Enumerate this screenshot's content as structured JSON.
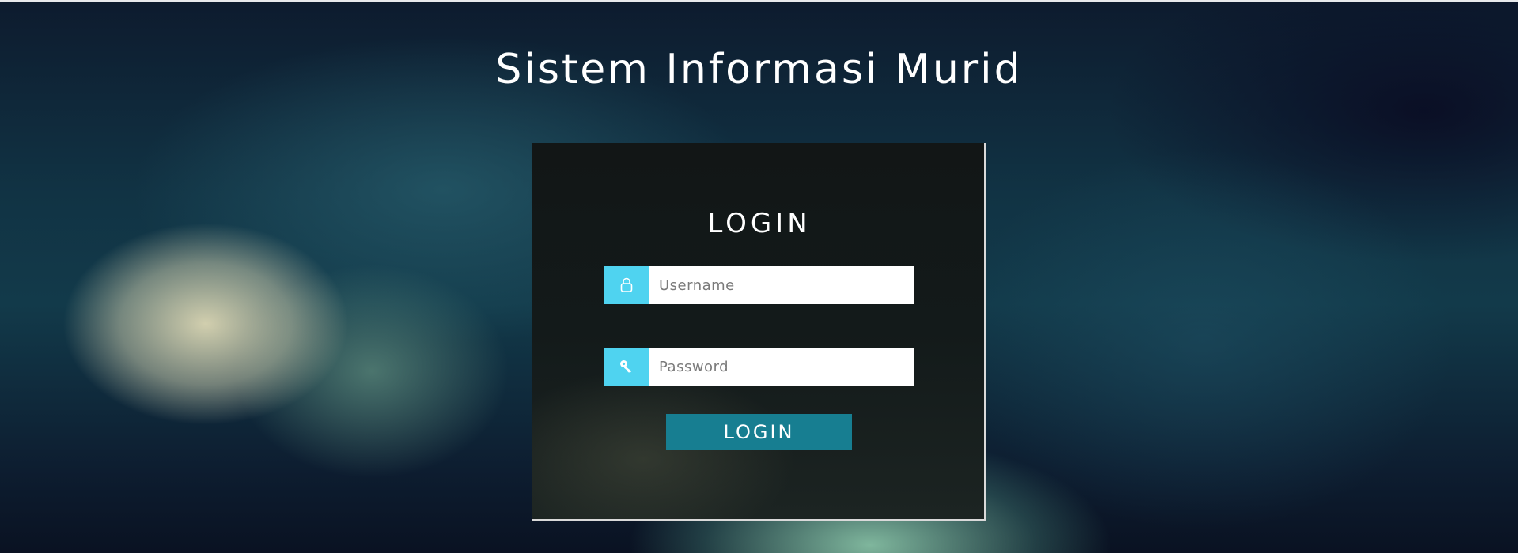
{
  "page": {
    "title": "Sistem Informasi Murid"
  },
  "login_form": {
    "heading": "LOGIN",
    "username": {
      "placeholder": "Username",
      "value": "",
      "icon": "user-icon"
    },
    "password": {
      "placeholder": "Password",
      "value": "",
      "icon": "key-icon"
    },
    "submit_label": "LOGIN"
  },
  "colors": {
    "addon_background": "#4fd3f0",
    "button_background": "#177e91",
    "text": "#ffffff"
  }
}
